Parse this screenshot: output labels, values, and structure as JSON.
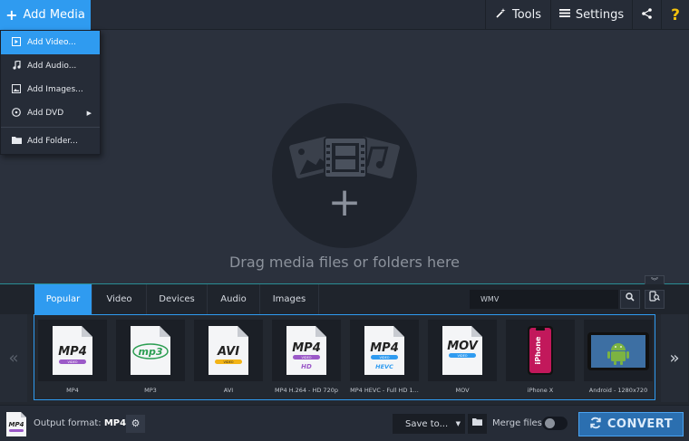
{
  "topbar": {
    "add_media_label": "Add Media",
    "tools_label": "Tools",
    "settings_label": "Settings",
    "help_label": "?"
  },
  "dropdown": {
    "items": [
      {
        "label": "Add Video...",
        "icon": "video-icon",
        "active": true
      },
      {
        "label": "Add Audio...",
        "icon": "music-note-icon"
      },
      {
        "label": "Add Images...",
        "icon": "image-icon"
      },
      {
        "label": "Add DVD",
        "icon": "disc-icon",
        "has_submenu": true
      },
      {
        "label": "Add Folder...",
        "icon": "folder-icon"
      }
    ]
  },
  "dropzone": {
    "hint": "Drag media files or folders here"
  },
  "tabs": [
    "Popular",
    "Video",
    "Devices",
    "Audio",
    "Images"
  ],
  "active_tab": "Popular",
  "search": {
    "value": "WMV"
  },
  "formats": [
    {
      "label": "MP4",
      "badge": "MP4",
      "sub": "VIDEO",
      "color": "#9b59c8"
    },
    {
      "label": "MP3",
      "badge": "mp3",
      "sub": "",
      "color": "#2c9e52"
    },
    {
      "label": "AVI",
      "badge": "AVI",
      "sub": "VIDEO",
      "color": "#f3b416"
    },
    {
      "label": "MP4 H.264 - HD 720p",
      "badge": "MP4",
      "sub": "VIDEO",
      "extra": "HD",
      "color": "#9b59c8"
    },
    {
      "label": "MP4 HEVC - Full HD 1...",
      "badge": "MP4",
      "sub": "VIDEO",
      "extra": "HEVC",
      "color": "#2f9bf0"
    },
    {
      "label": "MOV",
      "badge": "MOV",
      "sub": "VIDEO",
      "color": "#2f9bf0"
    },
    {
      "label": "iPhone X",
      "badge": "iPhone",
      "sub": "",
      "color": "#c2185b"
    },
    {
      "label": "Android - 1280x720",
      "badge": "",
      "sub": "",
      "color": "#7cb342"
    }
  ],
  "bottombar": {
    "output_prefix": "Output format:",
    "output_value": "MP4",
    "save_to_label": "Save to...",
    "merge_label": "Merge files:",
    "convert_label": "CONVERT"
  },
  "colors": {
    "accent": "#2f9bf0",
    "background": "#2b313d",
    "convert": "#2b6fb0"
  }
}
